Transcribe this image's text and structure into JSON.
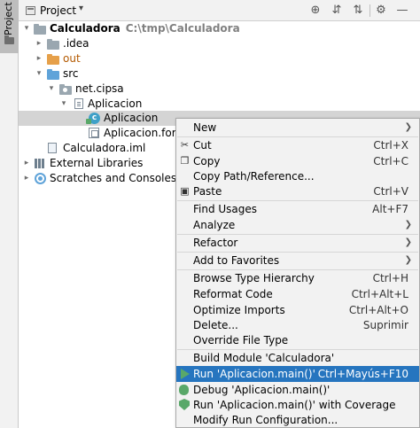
{
  "sidebar": {
    "tab_label": "Project"
  },
  "header": {
    "title": "Project",
    "caret": "▾",
    "toolbar": {
      "locate": "⊕",
      "expand": "⇵",
      "collapse": "⇅",
      "settings": "⚙",
      "hide": "—"
    }
  },
  "tree": {
    "root": {
      "label": "Calculadora",
      "path": "C:\\tmp\\Calculadora"
    },
    "idea": ".idea",
    "out": "out",
    "src": "src",
    "package": "net.cipsa",
    "folder": "Aplicacion",
    "class_file": "Aplicacion",
    "form_file": "Aplicacion.form",
    "iml": "Calculadora.iml",
    "external": "External Libraries",
    "scratches": "Scratches and Consoles"
  },
  "menu": {
    "new": "New",
    "cut": "Cut",
    "cut_sc": "Ctrl+X",
    "copy": "Copy",
    "copy_sc": "Ctrl+C",
    "copy_path": "Copy Path/Reference...",
    "paste": "Paste",
    "paste_sc": "Ctrl+V",
    "find_usages": "Find Usages",
    "find_usages_sc": "Alt+F7",
    "analyze": "Analyze",
    "refactor": "Refactor",
    "add_favorites": "Add to Favorites",
    "browse_hierarchy": "Browse Type Hierarchy",
    "browse_hierarchy_sc": "Ctrl+H",
    "reformat": "Reformat Code",
    "reformat_sc": "Ctrl+Alt+L",
    "optimize": "Optimize Imports",
    "optimize_sc": "Ctrl+Alt+O",
    "delete": "Delete...",
    "delete_sc": "Suprimir",
    "override_type": "Override File Type",
    "build_module": "Build Module 'Calculadora'",
    "run": "Run 'Aplicacion.main()'",
    "run_sc": "Ctrl+Mayús+F10",
    "debug": "Debug 'Aplicacion.main()'",
    "coverage": "Run 'Aplicacion.main()' with Coverage",
    "modify_run": "Modify Run Configuration..."
  },
  "colors": {
    "highlight": "#2675bf",
    "selection": "#d4d4d4"
  }
}
